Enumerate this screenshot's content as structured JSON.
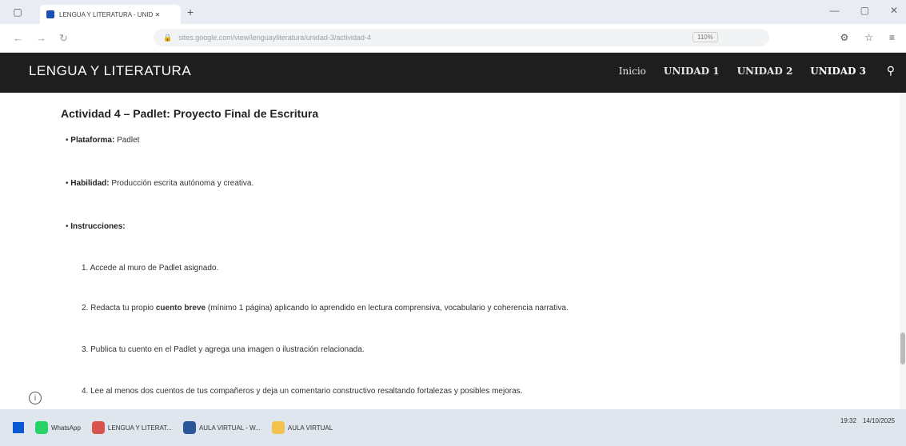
{
  "browser": {
    "tab_title": "LENGUA Y LITERATURA - UNID ✕",
    "url": "sites.google.com/view/lenguayliteratura/unidad-3/actividad-4",
    "zoom": "110%"
  },
  "site": {
    "title": "LENGUA Y LITERATURA",
    "nav": [
      "Inicio",
      "UNIDAD 1",
      "UNIDAD 2",
      "UNIDAD 3"
    ]
  },
  "activity": {
    "title": "Actividad 4 – Padlet: Proyecto Final de Escritura",
    "platform_label": "Plataforma:",
    "platform_value": "Padlet",
    "skill_label": "Habilidad:",
    "skill_value": "Producción escrita autónoma y creativa.",
    "instructions_label": "Instrucciones:",
    "steps": [
      "1. Accede al muro de Padlet asignado.",
      "2. Redacta tu propio",
      "cuento breve",
      "(mínimo 1 página) aplicando lo aprendido en lectura comprensiva, vocabulario y coherencia narrativa.",
      "3. Publica tu cuento en el Padlet y agrega una imagen o ilustración relacionada.",
      "4. Lee al menos dos cuentos de tus compañeros y deja un comentario constructivo resaltando fortalezas y posibles mejoras."
    ]
  },
  "taskbar": {
    "apps": [
      "WhatsApp",
      "LENGUA Y LITERAT...",
      "AULA VIRTUAL - W...",
      "AULA VIRTUAL"
    ],
    "time": "19:32",
    "date": "14/10/2025"
  },
  "colors": {
    "header_bg": "#1e1e1e",
    "content_bg": "#ffffff"
  }
}
